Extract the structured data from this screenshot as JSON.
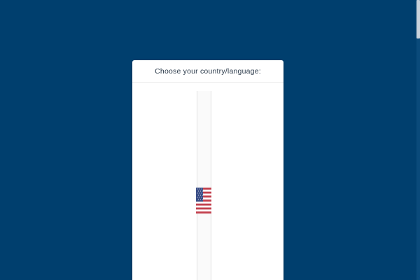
{
  "modal": {
    "title": "Choose your country/language:"
  },
  "countries": [
    {
      "icon": "us-flag-icon",
      "colors": {
        "red": "#c2404d",
        "white": "#ffffff",
        "blue": "#3b4f87"
      }
    }
  ],
  "colors": {
    "background": "#003f6e",
    "panel": "#ffffff",
    "title_text": "#2b3a4a"
  }
}
